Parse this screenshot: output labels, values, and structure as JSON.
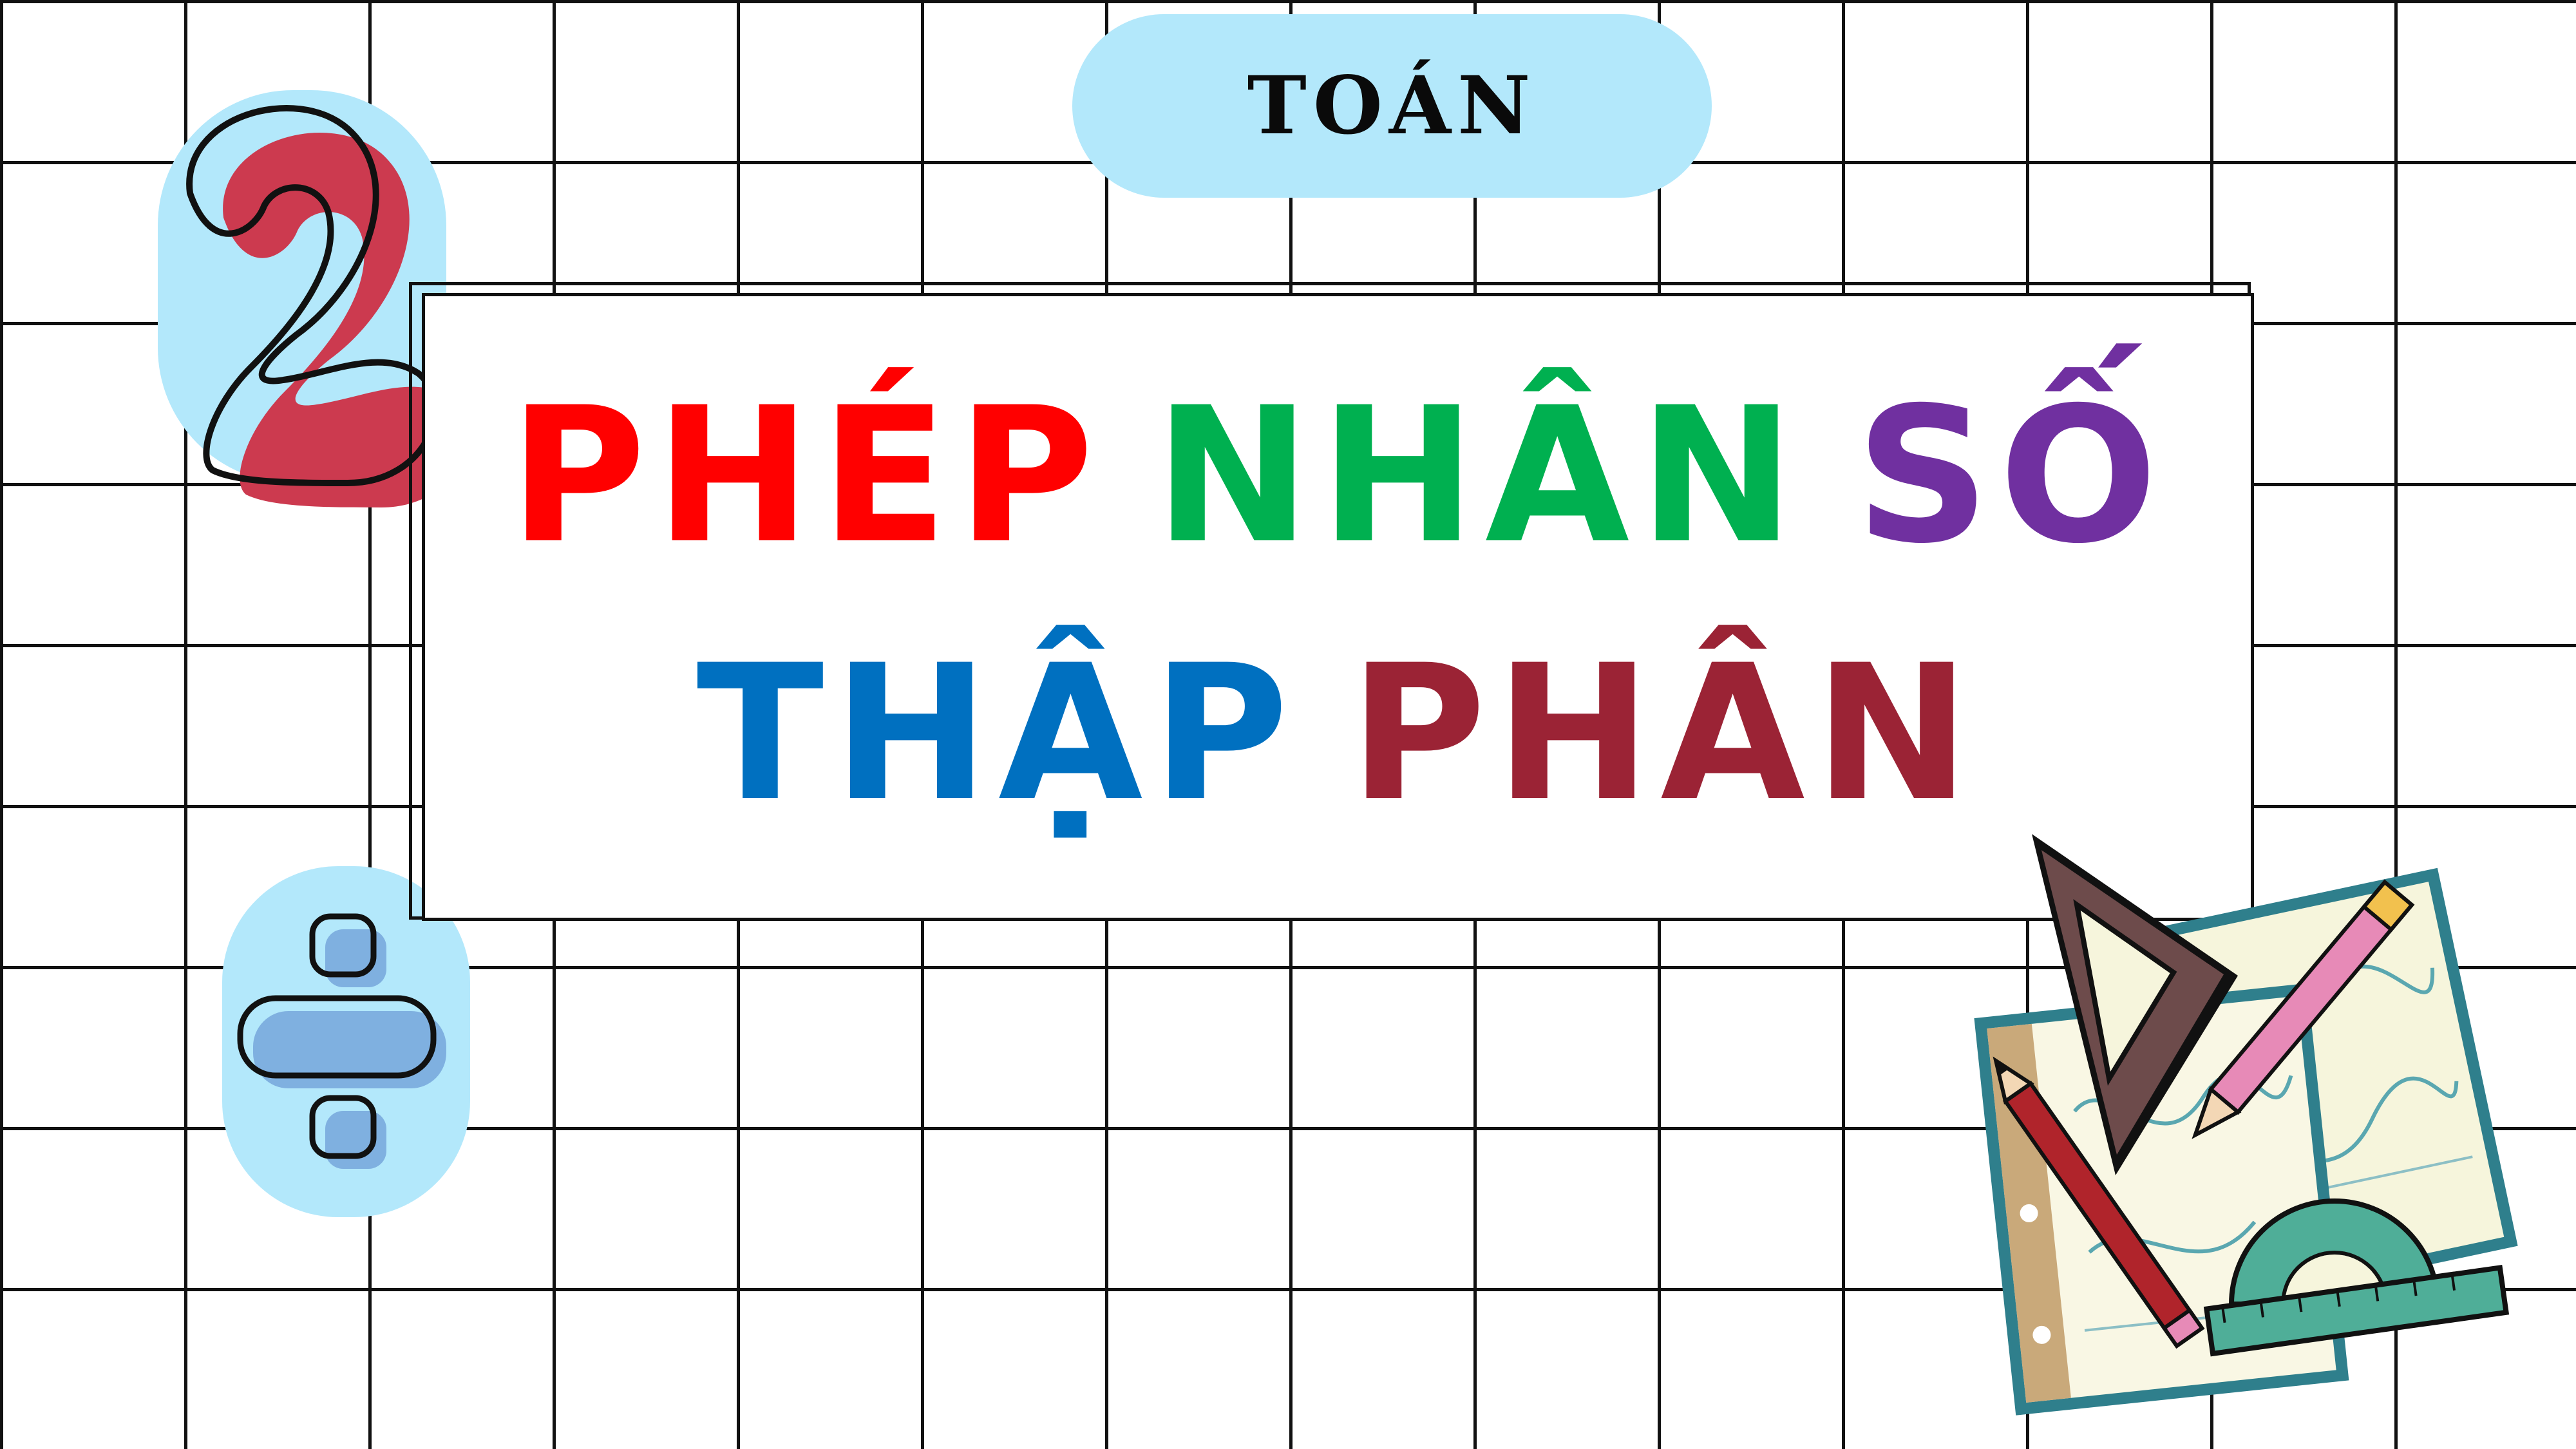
{
  "subject": {
    "label": "TOÁN"
  },
  "title": {
    "line1": [
      {
        "text": "PHÉP",
        "color": "#ff0000"
      },
      {
        "text": "NHÂN",
        "color": "#00b050"
      },
      {
        "text": "SỐ",
        "color": "#7030a0"
      }
    ],
    "line2": [
      {
        "text": "THẬP",
        "color": "#0070c0"
      },
      {
        "text": "PHÂN",
        "color": "#9b2335"
      }
    ]
  },
  "decorations": {
    "badge_color": "#b3e8fb",
    "two_icon_color": "#cc3a4f",
    "divide_icon_color": "#7fb0e0",
    "icons": [
      "number-two-icon",
      "divide-icon",
      "math-tools-illustration"
    ]
  }
}
